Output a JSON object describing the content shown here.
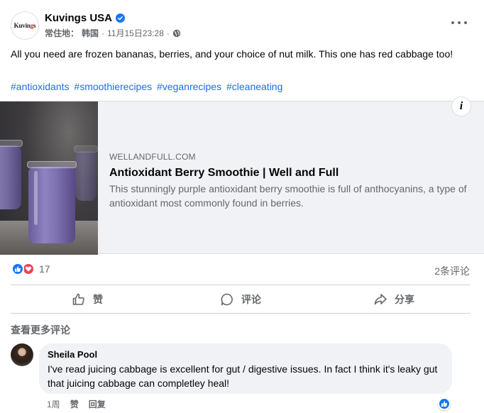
{
  "post": {
    "page_name": "Kuvings USA",
    "logo_text": "Kuvings",
    "location_label": "常住地：",
    "location": "韩国",
    "separator": "·",
    "timestamp": "11月15日23:28",
    "separator2": "·",
    "text": "All you need are frozen bananas, berries, and your choice of nut milk. This one has red cabbage too!",
    "hashtags": [
      "#antioxidants",
      "#smoothierecipes",
      "#veganrecipes",
      "#cleaneating"
    ]
  },
  "link_preview": {
    "domain": "WELLANDFULL.COM",
    "title": "Antioxidant Berry Smoothie | Well and Full",
    "description": "This stunningly purple antioxidant berry smoothie is full of anthocyanins, a type of antioxidant most commonly found in berries.",
    "info_glyph": "i"
  },
  "stats": {
    "reaction_count": "17",
    "comment_count": "2条评论",
    "reactions": [
      "like",
      "love"
    ]
  },
  "actions": {
    "like": "赞",
    "comment": "评论",
    "share": "分享"
  },
  "comments_section": {
    "more_comments": "查看更多评论",
    "comment": {
      "author": "Sheila Pool",
      "text": "I've read juicing cabbage is excellent for gut / digestive issues. In fact I think it's leaky gut that juicing cabbage can completley heal!",
      "time": "1周",
      "like": "赞",
      "reply": "回复"
    }
  },
  "colors": {
    "accent": "#1877f2",
    "hashtag": "#216fdb",
    "secondary_text": "#65676b",
    "love": "#f33e58"
  }
}
